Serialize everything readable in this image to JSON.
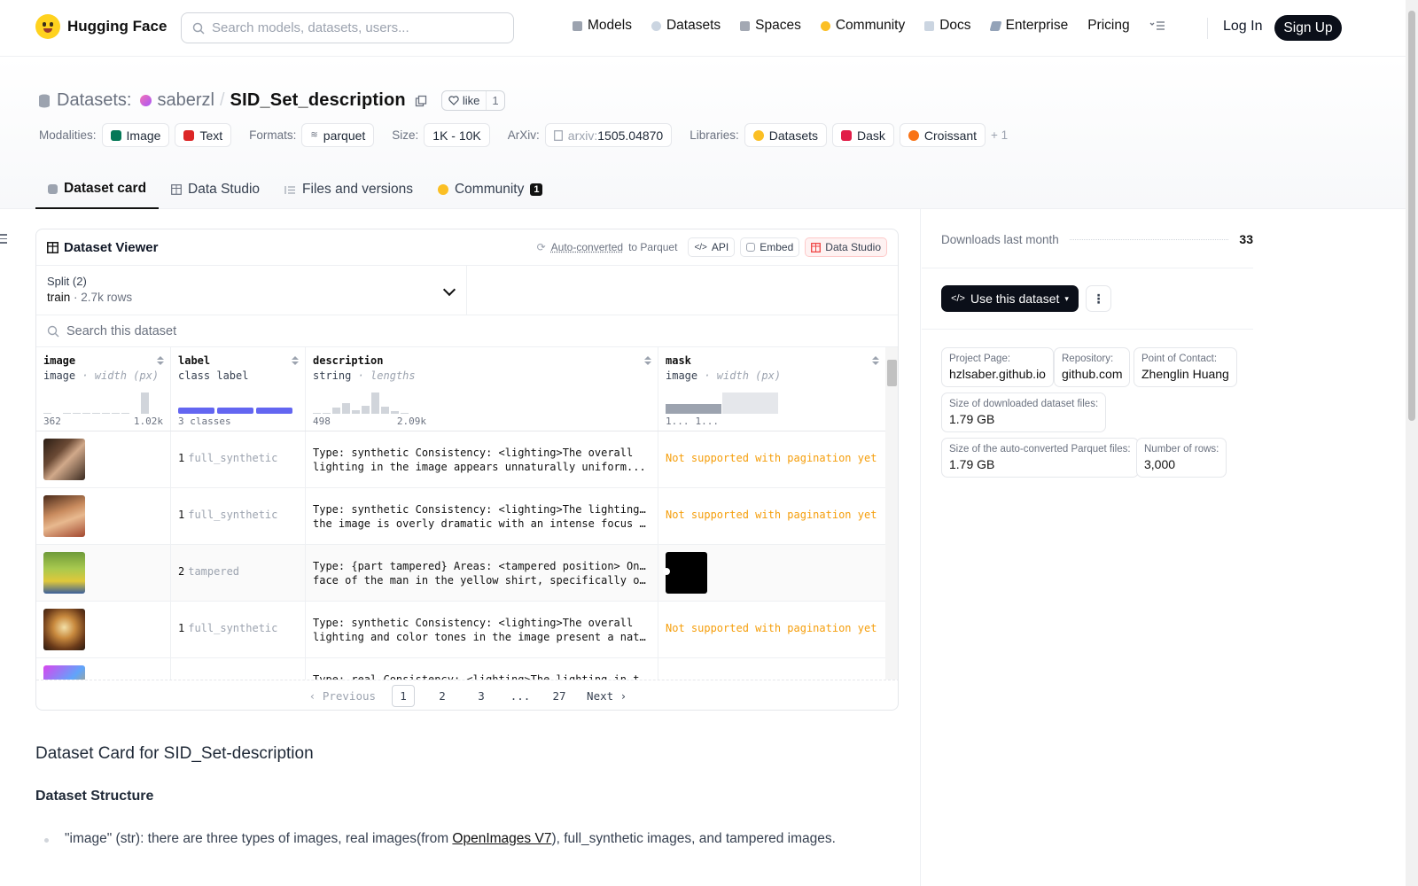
{
  "nav": {
    "brand": "Hugging Face",
    "search_placeholder": "Search models, datasets, users...",
    "links": [
      "Models",
      "Datasets",
      "Spaces",
      "Community",
      "Docs",
      "Enterprise",
      "Pricing"
    ],
    "login": "Log In",
    "signup": "Sign Up"
  },
  "header": {
    "section": "Datasets:",
    "owner": "saberzl",
    "separator": "/",
    "repo": "SID_Set_description",
    "like_label": "like",
    "like_count": "1",
    "modalities_label": "Modalities:",
    "modalities": [
      "Image",
      "Text"
    ],
    "formats_label": "Formats:",
    "format": "parquet",
    "size_label": "Size:",
    "size": "1K - 10K",
    "arxiv_label": "ArXiv:",
    "arxiv_prefix": "arxiv:",
    "arxiv_id": "1505.04870",
    "libraries_label": "Libraries:",
    "libraries": [
      "Datasets",
      "Dask",
      "Croissant"
    ],
    "libraries_more": "+ 1"
  },
  "tabs": {
    "dataset_card": "Dataset card",
    "data_studio": "Data Studio",
    "files": "Files and versions",
    "community": "Community",
    "community_count": "1"
  },
  "viewer": {
    "title": "Dataset Viewer",
    "auto_converted": "Auto-converted",
    "to_parquet": "to Parquet",
    "api": "API",
    "embed": "Embed",
    "data_studio": "Data Studio",
    "split_label": "Split (2)",
    "split_name": "train",
    "split_dot": "·",
    "split_rows": "2.7k rows",
    "search_placeholder": "Search this dataset",
    "columns": [
      {
        "name": "image",
        "type": "image",
        "extra": "· width (px)",
        "tick_min": "362",
        "tick_max": "1.02k"
      },
      {
        "name": "label",
        "type": "class label",
        "extra": "",
        "tick_min": "3 classes",
        "tick_max": ""
      },
      {
        "name": "description",
        "type": "string",
        "extra": "· lengths",
        "tick_min": "498",
        "tick_max": "2.09k"
      },
      {
        "name": "mask",
        "type": "image",
        "extra": "· width (px)",
        "tick_min": "1...",
        "tick_max": "1..."
      }
    ],
    "rows": [
      {
        "label_id": "1",
        "label_name": "full_synthetic",
        "desc1": "Type: synthetic Consistency: <lighting>The overall",
        "desc2": "lighting in the image appears unnaturally uniform...",
        "mask": "Not supported with pagination yet"
      },
      {
        "label_id": "1",
        "label_name": "full_synthetic",
        "desc1": "Type: synthetic Consistency: <lighting>The lighting in",
        "desc2": "the image is overly dramatic with an intense focus on...",
        "mask": "Not supported with pagination yet"
      },
      {
        "label_id": "2",
        "label_name": "tampered",
        "desc1": "Type: {part tampered} Areas: <tampered position> On the",
        "desc2": "face of the man in the yellow shirt, specifically over...",
        "mask": ""
      },
      {
        "label_id": "1",
        "label_name": "full_synthetic",
        "desc1": "Type: synthetic Consistency: <lighting>The overall",
        "desc2": "lighting and color tones in the image present a natura...",
        "mask": "Not supported with pagination yet"
      },
      {
        "label_id": "",
        "label_name": "",
        "desc1": "Type: real Consistency: <lighting>The lighting in the",
        "desc2": "",
        "mask": ""
      }
    ],
    "pager": {
      "prev": "Previous",
      "pages": [
        "1",
        "2",
        "3",
        "...",
        "27"
      ],
      "next": "Next"
    }
  },
  "card": {
    "title": "Dataset Card for SID_Set-description",
    "structure": "Dataset Structure",
    "li_pre": "\"image\" (str): there are three types of images, real images(from ",
    "li_link": "OpenImages V7",
    "li_post": "), full_synthetic images, and tampered images."
  },
  "sidebar": {
    "downloads_label": "Downloads last month",
    "downloads_value": "33",
    "use_dataset": "Use this dataset",
    "project_page_k": "Project Page:",
    "project_page_v": "hzlsaber.github.io",
    "repository_k": "Repository:",
    "repository_v": "github.com",
    "contact_k": "Point of Contact:",
    "contact_v": "Zhenglin Huang",
    "dl_size_k": "Size of downloaded dataset files:",
    "dl_size_v": "1.79 GB",
    "pq_size_k": "Size of the auto-converted Parquet files:",
    "pq_size_v": "1.79 GB",
    "rows_k": "Number of rows:",
    "rows_v": "3,000"
  },
  "colors": {
    "accent_dark": "#0b0f19",
    "warning": "#f59e0b",
    "label_bar": "#6366f1"
  }
}
